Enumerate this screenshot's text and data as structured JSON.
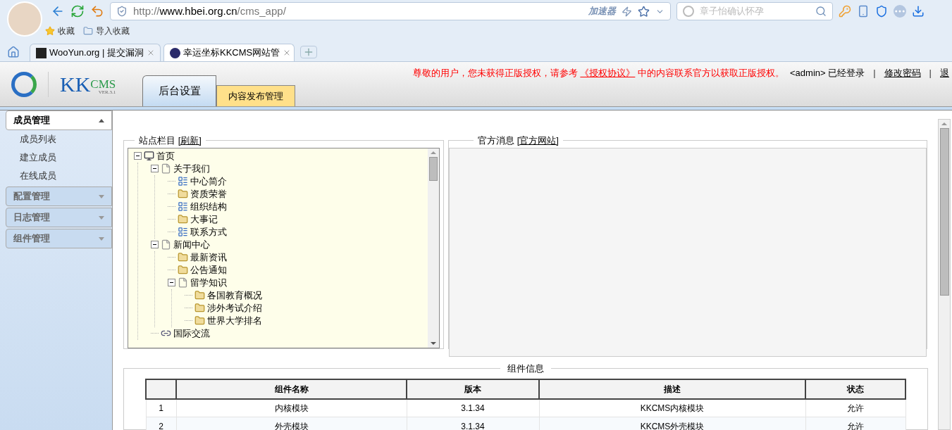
{
  "browser": {
    "address": {
      "scheme": "http://",
      "host": "www.hbei.org.cn",
      "path": "/cms_app/",
      "accelerator": "加速器"
    },
    "search": {
      "placeholder": "章子怡确认怀孕"
    },
    "bookmarks": [
      {
        "label": "收藏",
        "kind": "star"
      },
      {
        "label": "导入收藏",
        "kind": "folder"
      }
    ],
    "tabs": [
      {
        "title": "WooYun.org | 提交漏洞",
        "selected": false
      },
      {
        "title": "幸运坐标KKCMS网站管",
        "selected": true
      }
    ]
  },
  "app": {
    "logo": {
      "brand": "KK",
      "suffix": "CMS",
      "version": "VER.3.1"
    },
    "tabs": [
      {
        "label": "后台设置",
        "selected": true
      },
      {
        "label": "内容发布管理",
        "selected": false
      }
    ],
    "notice": {
      "text_before": "尊敬的用户，您未获得正版授权，请参考",
      "license_link": "《授权协议》",
      "text_after": "中的内容联系官方以获取正版授权。",
      "user": "<admin>",
      "status": "已经登录"
    },
    "links": [
      {
        "separator": "|",
        "label": "修改密码"
      },
      {
        "separator": "|",
        "label": "退"
      }
    ]
  },
  "sidebar": [
    {
      "title": "成员管理",
      "expanded": true,
      "items": [
        "成员列表",
        "建立成员",
        "在线成员"
      ]
    },
    {
      "title": "配置管理",
      "expanded": false
    },
    {
      "title": "日志管理",
      "expanded": false
    },
    {
      "title": "组件管理",
      "expanded": false
    }
  ],
  "site_columns": {
    "title": "站点栏目",
    "refresh": "[刷新]",
    "tree": [
      {
        "label": "首页",
        "kind": "root",
        "expanded": true,
        "children": [
          {
            "label": "关于我们",
            "kind": "page",
            "expanded": true,
            "children": [
              {
                "label": "中心简介",
                "kind": "list"
              },
              {
                "label": "资质荣誉",
                "kind": "folder"
              },
              {
                "label": "组织结构",
                "kind": "list"
              },
              {
                "label": "大事记",
                "kind": "folder"
              },
              {
                "label": "联系方式",
                "kind": "list"
              }
            ]
          },
          {
            "label": "新闻中心",
            "kind": "page",
            "expanded": true,
            "children": [
              {
                "label": "最新资讯",
                "kind": "folder"
              },
              {
                "label": "公告通知",
                "kind": "folder"
              },
              {
                "label": "留学知识",
                "kind": "page",
                "expanded": true,
                "children": [
                  {
                    "label": "各国教育概况",
                    "kind": "folder"
                  },
                  {
                    "label": "涉外考试介绍",
                    "kind": "folder"
                  },
                  {
                    "label": "世界大学排名",
                    "kind": "folder"
                  }
                ]
              }
            ]
          },
          {
            "label": "国际交流",
            "kind": "link"
          }
        ]
      }
    ]
  },
  "news_panel": {
    "title": "官方消息",
    "link": "[官方网站]"
  },
  "components": {
    "title": "组件信息",
    "columns": [
      "",
      "组件名称",
      "版本",
      "描述",
      "状态"
    ],
    "rows": [
      [
        "1",
        "内核模块",
        "3.1.34",
        "KKCMS内核模块",
        "允许"
      ],
      [
        "2",
        "外壳模块",
        "3.1.34",
        "KKCMS外壳模块",
        "允许"
      ]
    ]
  }
}
